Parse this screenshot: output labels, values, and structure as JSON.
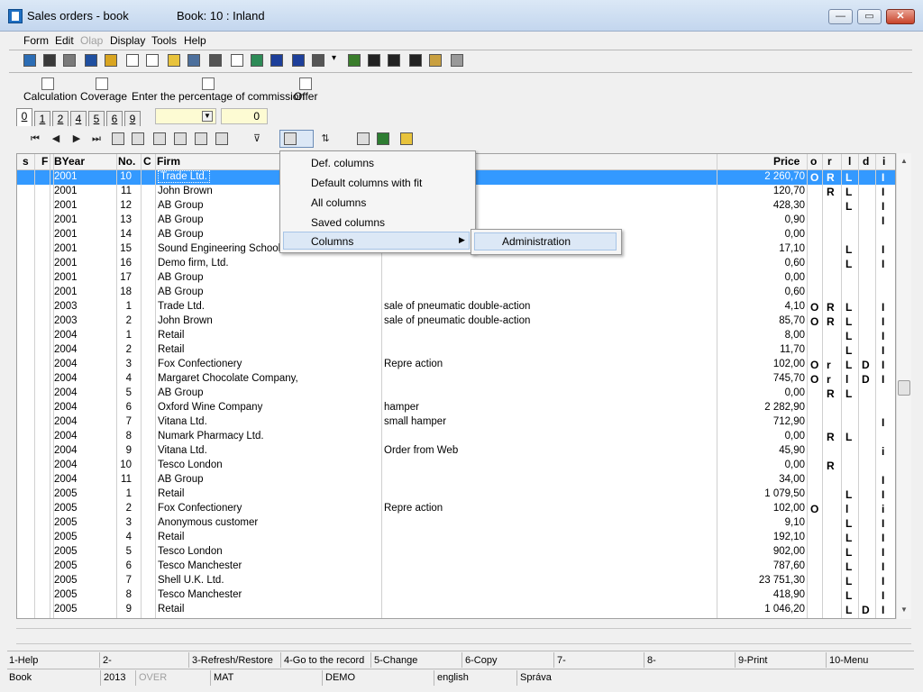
{
  "window": {
    "title": "Sales orders - book",
    "book": "Book: 10 : Inland",
    "minimize_glyph": "—",
    "maximize_glyph": "▭",
    "close_glyph": "✕"
  },
  "menu": [
    "Form",
    "Edit",
    "Olap",
    "Display",
    "Tools",
    "Help"
  ],
  "toolbar2": {
    "calculation": "Calculation",
    "coverage": "Coverage",
    "commission": "Enter the percentage of commission",
    "offer": "Offer"
  },
  "tabs": [
    "0",
    "1",
    "2",
    "4",
    "5",
    "6",
    "9"
  ],
  "filter_value": "0",
  "columns": {
    "s": "s",
    "f": "F",
    "byear": "BYear",
    "no": "No.",
    "c": "C",
    "firm": "Firm",
    "price": "Price",
    "o": "o",
    "r": "r",
    "l": "l",
    "d": "d",
    "i": "i"
  },
  "rows": [
    {
      "byear": "2001",
      "no": "10",
      "firm": "Trade Ltd.",
      "desc": "",
      "price": "2 260,70",
      "o": "O",
      "r": "R",
      "l": "L",
      "d": "",
      "i": "I",
      "selected": true
    },
    {
      "byear": "2001",
      "no": "11",
      "firm": "John Brown",
      "desc": "",
      "price": "120,70",
      "o": "",
      "r": "R",
      "l": "L",
      "d": "",
      "i": "I"
    },
    {
      "byear": "2001",
      "no": "12",
      "firm": "AB Group",
      "desc": "",
      "price": "428,30",
      "o": "",
      "r": "",
      "l": "L",
      "d": "",
      "i": "I"
    },
    {
      "byear": "2001",
      "no": "13",
      "firm": "AB Group",
      "desc": "",
      "price": "0,90",
      "o": "",
      "r": "",
      "l": "",
      "d": "",
      "i": "I"
    },
    {
      "byear": "2001",
      "no": "14",
      "firm": "AB Group",
      "desc": "",
      "price": "0,00",
      "o": "",
      "r": "",
      "l": "",
      "d": "",
      "i": ""
    },
    {
      "byear": "2001",
      "no": "15",
      "firm": "Sound Engineering School",
      "desc": "",
      "price": "17,10",
      "o": "",
      "r": "",
      "l": "L",
      "d": "",
      "i": "I"
    },
    {
      "byear": "2001",
      "no": "16",
      "firm": "Demo firm, Ltd.",
      "desc": "",
      "price": "0,60",
      "o": "",
      "r": "",
      "l": "L",
      "d": "",
      "i": "I"
    },
    {
      "byear": "2001",
      "no": "17",
      "firm": "AB Group",
      "desc": "",
      "price": "0,00",
      "o": "",
      "r": "",
      "l": "",
      "d": "",
      "i": ""
    },
    {
      "byear": "2001",
      "no": "18",
      "firm": "AB Group",
      "desc": "",
      "price": "0,60",
      "o": "",
      "r": "",
      "l": "",
      "d": "",
      "i": ""
    },
    {
      "byear": "2003",
      "no": "1",
      "firm": "Trade Ltd.",
      "desc": "sale of pneumatic double-action",
      "price": "4,10",
      "o": "O",
      "r": "R",
      "l": "L",
      "d": "",
      "i": "I"
    },
    {
      "byear": "2003",
      "no": "2",
      "firm": "John Brown",
      "desc": "sale of pneumatic double-action",
      "price": "85,70",
      "o": "O",
      "r": "R",
      "l": "L",
      "d": "",
      "i": "I"
    },
    {
      "byear": "2004",
      "no": "1",
      "firm": "Retail",
      "desc": "",
      "price": "8,00",
      "o": "",
      "r": "",
      "l": "L",
      "d": "",
      "i": "I"
    },
    {
      "byear": "2004",
      "no": "2",
      "firm": "Retail",
      "desc": "",
      "price": "11,70",
      "o": "",
      "r": "",
      "l": "L",
      "d": "",
      "i": "I"
    },
    {
      "byear": "2004",
      "no": "3",
      "firm": "Fox Confectionery",
      "desc": "Repre action",
      "price": "102,00",
      "o": "O",
      "r": "r",
      "l": "L",
      "d": "D",
      "i": "I"
    },
    {
      "byear": "2004",
      "no": "4",
      "firm": "Margaret Chocolate Company,",
      "desc": "",
      "price": "745,70",
      "o": "O",
      "r": "r",
      "l": "l",
      "d": "D",
      "i": "I"
    },
    {
      "byear": "2004",
      "no": "5",
      "firm": "AB Group",
      "desc": "",
      "price": "0,00",
      "o": "",
      "r": "R",
      "l": "L",
      "d": "",
      "i": ""
    },
    {
      "byear": "2004",
      "no": "6",
      "firm": "Oxford Wine Company",
      "desc": "hamper",
      "price": "2 282,90",
      "o": "",
      "r": "",
      "l": "",
      "d": "",
      "i": ""
    },
    {
      "byear": "2004",
      "no": "7",
      "firm": "Vitana Ltd.",
      "desc": "small hamper",
      "price": "712,90",
      "o": "",
      "r": "",
      "l": "",
      "d": "",
      "i": "I"
    },
    {
      "byear": "2004",
      "no": "8",
      "firm": "Numark Pharmacy Ltd.",
      "desc": "",
      "price": "0,00",
      "o": "",
      "r": "R",
      "l": "L",
      "d": "",
      "i": ""
    },
    {
      "byear": "2004",
      "no": "9",
      "firm": "Vitana Ltd.",
      "desc": "Order from Web",
      "price": "45,90",
      "o": "",
      "r": "",
      "l": "",
      "d": "",
      "i": "i"
    },
    {
      "byear": "2004",
      "no": "10",
      "firm": "Tesco London",
      "desc": "",
      "price": "0,00",
      "o": "",
      "r": "R",
      "l": "",
      "d": "",
      "i": ""
    },
    {
      "byear": "2004",
      "no": "11",
      "firm": "AB Group",
      "desc": "",
      "price": "34,00",
      "o": "",
      "r": "",
      "l": "",
      "d": "",
      "i": "I"
    },
    {
      "byear": "2005",
      "no": "1",
      "firm": "Retail",
      "desc": "",
      "price": "1 079,50",
      "o": "",
      "r": "",
      "l": "L",
      "d": "",
      "i": "I"
    },
    {
      "byear": "2005",
      "no": "2",
      "firm": "Fox Confectionery",
      "desc": "Repre action",
      "price": "102,00",
      "o": "O",
      "r": "",
      "l": "l",
      "d": "",
      "i": "i"
    },
    {
      "byear": "2005",
      "no": "3",
      "firm": "Anonymous customer",
      "desc": "",
      "price": "9,10",
      "o": "",
      "r": "",
      "l": "L",
      "d": "",
      "i": "I"
    },
    {
      "byear": "2005",
      "no": "4",
      "firm": "Retail",
      "desc": "",
      "price": "192,10",
      "o": "",
      "r": "",
      "l": "L",
      "d": "",
      "i": "I"
    },
    {
      "byear": "2005",
      "no": "5",
      "firm": "Tesco London",
      "desc": "",
      "price": "902,00",
      "o": "",
      "r": "",
      "l": "L",
      "d": "",
      "i": "I"
    },
    {
      "byear": "2005",
      "no": "6",
      "firm": "Tesco Manchester",
      "desc": "",
      "price": "787,60",
      "o": "",
      "r": "",
      "l": "L",
      "d": "",
      "i": "I"
    },
    {
      "byear": "2005",
      "no": "7",
      "firm": "Shell U.K. Ltd.",
      "desc": "",
      "price": "23 751,30",
      "o": "",
      "r": "",
      "l": "L",
      "d": "",
      "i": "I"
    },
    {
      "byear": "2005",
      "no": "8",
      "firm": "Tesco Manchester",
      "desc": "",
      "price": "418,90",
      "o": "",
      "r": "",
      "l": "L",
      "d": "",
      "i": "I"
    },
    {
      "byear": "2005",
      "no": "9",
      "firm": "Retail",
      "desc": "",
      "price": "1 046,20",
      "o": "",
      "r": "",
      "l": "L",
      "d": "D",
      "i": "I"
    }
  ],
  "context_menu": [
    "Def. columns",
    "Default columns with fit",
    "All columns",
    "Saved columns",
    "Columns"
  ],
  "submenu": [
    "Administration"
  ],
  "function_keys": [
    "1-Help",
    "2-",
    "3-Refresh/Restore",
    "4-Go to the record",
    "5-Change",
    "6-Copy",
    "7-",
    "8-",
    "9-Print",
    "10-Menu"
  ],
  "statusbar": [
    "Book",
    "2013",
    "OVER",
    "MAT",
    "DEMO",
    "english",
    "Správa"
  ],
  "icons": {
    "toolbar1": [
      "tree-icon",
      "save-icon",
      "save-as-icon",
      "undo-icon",
      "open-folder-icon",
      "new-document-icon",
      "copy-icon",
      "copy2-icon",
      "book-icon",
      "filter-icon",
      "report-icon",
      "stack-icon",
      "arrow-up-icon",
      "arrow-down-icon",
      "camera-icon",
      "dropdown-icon",
      "check-person-icon",
      "binoculars-icon",
      "binoculars2-icon",
      "binoculars3-icon",
      "mail-icon",
      "edit-disabled-icon"
    ],
    "toolbar3": [
      "first-record-icon",
      "previous-record-icon",
      "next-record-icon",
      "last-record-icon",
      "refresh-icon",
      "binoculars-icon",
      "print-icon",
      "add-record-icon",
      "delete-record-icon",
      "camera-icon",
      "filter-icon",
      "columns-icon",
      "sort-az-icon",
      "list-icon",
      "excel-icon",
      "sheet-icon"
    ]
  },
  "colors": {
    "selection": "#3399ff",
    "titlebar": "#c3d6ee"
  }
}
